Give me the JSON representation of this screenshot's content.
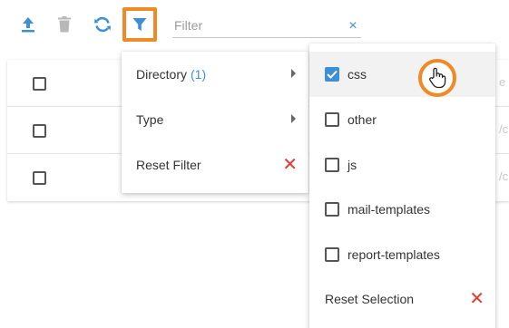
{
  "toolbar": {
    "upload_icon": "upload-icon",
    "delete_icon": "trash-icon",
    "refresh_icon": "sync-icon",
    "filter_icon": "filter-icon",
    "accent_color": "#3d8fd6",
    "highlight_color": "#f08a24"
  },
  "filter": {
    "placeholder": "Filter",
    "value": "",
    "clear_label": "×"
  },
  "table": {
    "rows": [
      {
        "trail": "e"
      },
      {
        "trail": "/c"
      },
      {
        "trail": "/c"
      }
    ]
  },
  "filter_menu": {
    "items": [
      {
        "label": "Directory",
        "count": "(1)"
      },
      {
        "label": "Type"
      },
      {
        "label": "Reset Filter",
        "action_icon": "close-icon"
      }
    ]
  },
  "directory_menu": {
    "options": [
      {
        "label": "css",
        "checked": true
      },
      {
        "label": "other",
        "checked": false
      },
      {
        "label": "js",
        "checked": false
      },
      {
        "label": "mail-templates",
        "checked": false
      },
      {
        "label": "report-templates",
        "checked": false
      }
    ],
    "reset_label": "Reset Selection",
    "reset_icon": "close-icon"
  },
  "cursor": {
    "icon": "hand-pointer-icon"
  }
}
